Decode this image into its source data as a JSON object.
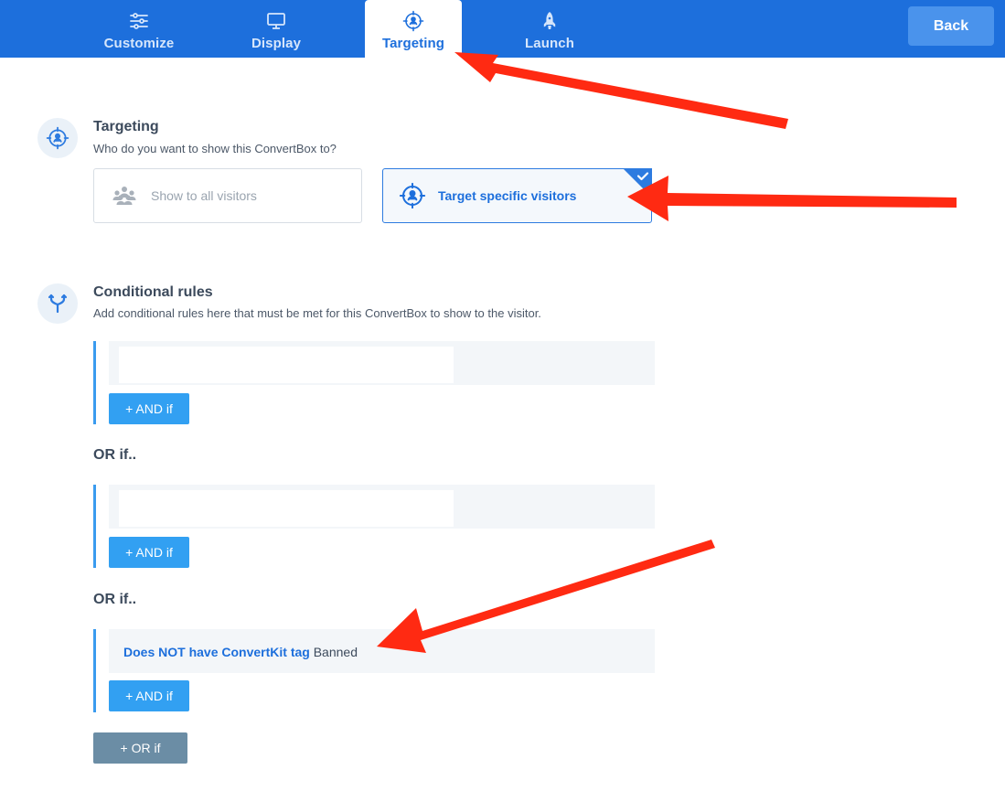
{
  "tabs": {
    "customize": "Customize",
    "display": "Display",
    "targeting": "Targeting",
    "launch": "Launch"
  },
  "back_label": "Back",
  "targeting": {
    "title": "Targeting",
    "description": "Who do you want to show this ConvertBox to?",
    "options": {
      "all": "Show to all visitors",
      "specific": "Target specific visitors"
    },
    "selected": "specific"
  },
  "conditional": {
    "title": "Conditional rules",
    "description": "Add conditional rules here that must be met for this ConvertBox to show to the visitor.",
    "and_label": "+ AND if",
    "or_label": "OR if..",
    "add_or_label": "+ OR if",
    "rule3": {
      "condition": "Does NOT have ConvertKit tag",
      "value": "Banned"
    }
  },
  "colors": {
    "topbar": "#1d6fdc",
    "accent": "#32a0f2",
    "annotation": "#ff2a12"
  }
}
